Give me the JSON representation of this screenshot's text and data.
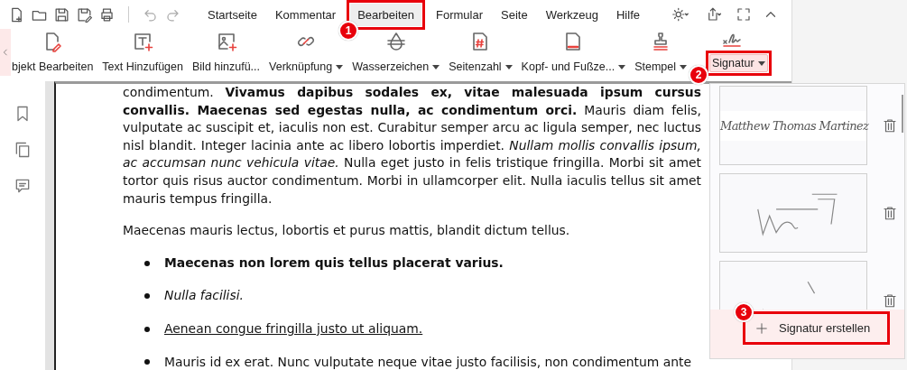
{
  "menu_tabs": [
    {
      "label": "Startseite",
      "selected": false
    },
    {
      "label": "Kommentar",
      "selected": false
    },
    {
      "label": "Bearbeiten",
      "selected": true,
      "callout": "1"
    },
    {
      "label": "Formular",
      "selected": false
    },
    {
      "label": "Seite",
      "selected": false
    },
    {
      "label": "Werkzeug",
      "selected": false
    },
    {
      "label": "Hilfe",
      "selected": false
    }
  ],
  "ribbon_tools": [
    {
      "label": "bjekt Bearbeiten",
      "dropdown": false,
      "selected": false
    },
    {
      "label": "Text Hinzufügen",
      "dropdown": false,
      "selected": false
    },
    {
      "label": "Bild hinzufü...",
      "dropdown": false,
      "selected": false
    },
    {
      "label": "Verknüpfung",
      "dropdown": true,
      "selected": false
    },
    {
      "label": "Wasserzeichen",
      "dropdown": true,
      "selected": false
    },
    {
      "label": "Seitenzahl",
      "dropdown": true,
      "selected": false
    },
    {
      "label": "Kopf- und Fußze...",
      "dropdown": true,
      "selected": false
    },
    {
      "label": "Stempel",
      "dropdown": true,
      "selected": false
    },
    {
      "label": "Signatur",
      "dropdown": true,
      "selected": true,
      "callout": "2"
    }
  ],
  "document": {
    "paragraphs": [
      "condimentum. **Vivamus dapibus sodales ex, vitae malesuada ipsum cursus convallis. Maecenas sed egestas nulla, ac condimentum orci.** Mauris diam felis, vulputate ac suscipit et, iaculis non est. Curabitur semper arcu ac ligula semper, nec luctus nisl blandit. Integer lacinia ante ac libero lobortis imperdiet. *Nullam mollis convallis ipsum, ac accumsan nunc vehicula vitae.* Nulla eget justo in felis tristique fringilla. Morbi sit amet tortor quis risus auctor condimentum. Morbi in ullamcorper elit. Nulla iaculis tellus sit amet mauris tempus fringilla.",
      "Maecenas mauris lectus, lobortis et purus mattis, blandit dictum tellus."
    ],
    "list": [
      {
        "text": "Maecenas non lorem quis tellus placerat varius.",
        "kind": "bold"
      },
      {
        "text": "Nulla facilisi.",
        "kind": "italic"
      },
      {
        "text": "Aenean congue fringilla justo ut aliquam. ",
        "kind": "underline"
      },
      {
        "text": "Mauris id ex erat. Nunc vulputate neque vitae justo facilisis, non condimentum ante",
        "kind": "plain"
      }
    ]
  },
  "signature_menu": {
    "signatures": [
      {
        "kind": "typed",
        "text": "Matthew Thomas Martinez"
      },
      {
        "kind": "drawn"
      },
      {
        "kind": "drawn"
      }
    ],
    "create_button": {
      "label": "Signatur erstellen",
      "callout": "3"
    }
  }
}
